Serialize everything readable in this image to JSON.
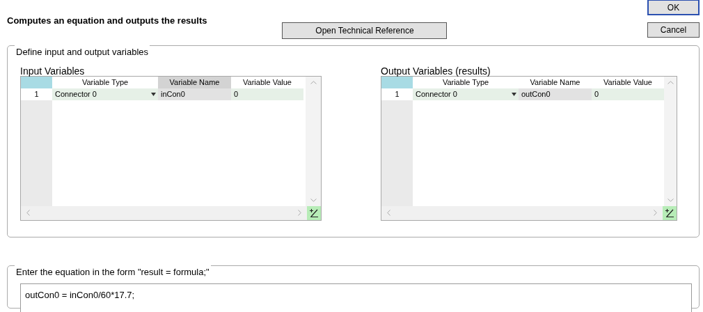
{
  "title": "Computes an equation and outputs the results",
  "buttons": {
    "reference": "Open Technical Reference",
    "ok": "OK",
    "cancel": "Cancel"
  },
  "variables_group": {
    "legend": "Define input and output variables",
    "grids": [
      {
        "label": "Input Variables",
        "columns": [
          {
            "label": "Variable Type",
            "selected": false
          },
          {
            "label": "Variable Name",
            "selected": true
          },
          {
            "label": "Variable Value",
            "selected": false
          }
        ],
        "rows": [
          {
            "number": "1",
            "type": "Connector 0",
            "name": "inCon0",
            "value": "0"
          }
        ]
      },
      {
        "label": "Output Variables (results)",
        "columns": [
          {
            "label": "Variable Type",
            "selected": false
          },
          {
            "label": "Variable Name",
            "selected": false
          },
          {
            "label": "Variable Value",
            "selected": false
          }
        ],
        "rows": [
          {
            "number": "1",
            "type": "Connector 0",
            "name": "outCon0",
            "value": "0"
          }
        ]
      }
    ]
  },
  "equation_group": {
    "legend": "Enter the equation in the form \"result = formula;\"",
    "value": "outCon0 = inCon0/60*17.7;"
  }
}
